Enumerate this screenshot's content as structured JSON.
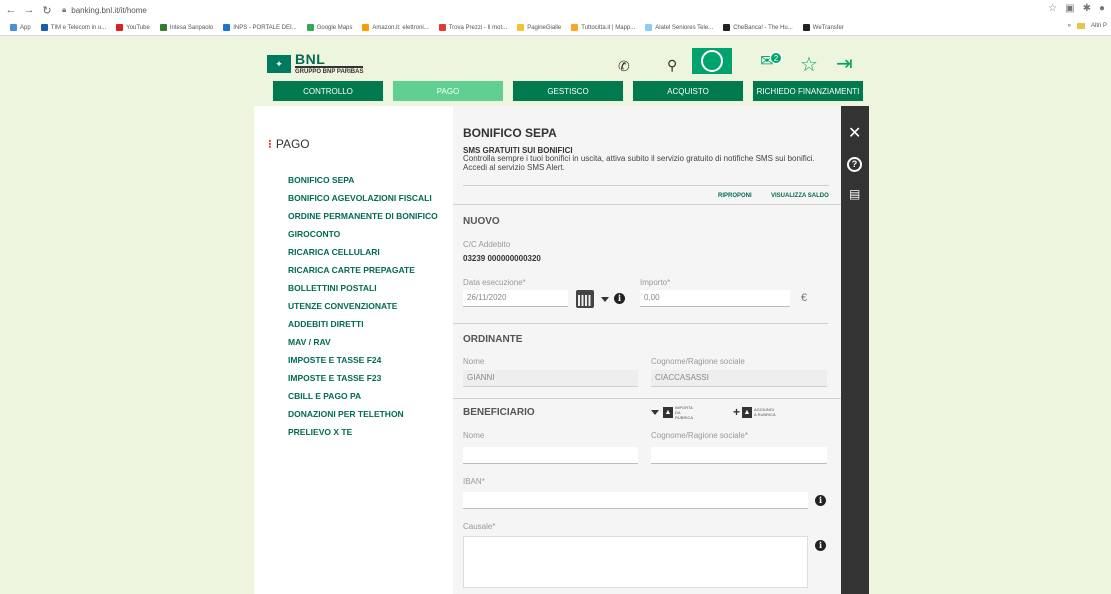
{
  "browser": {
    "url": "banking.bnl.it/it/home",
    "bookmarks": [
      {
        "label": "App",
        "color": "#4a90d9"
      },
      {
        "label": "TIM e Telecom in u...",
        "color": "#1a5bb5"
      },
      {
        "label": "YouTube",
        "color": "#e02020"
      },
      {
        "label": "Intesa Sanpaolo",
        "color": "#2e7d32"
      },
      {
        "label": "INPS - PORTALE DEI...",
        "color": "#1976d2"
      },
      {
        "label": "Google Maps",
        "color": "#34a853"
      },
      {
        "label": "Amazon.it: elettroni...",
        "color": "#ff9900"
      },
      {
        "label": "Trova Prezzi - Il mot...",
        "color": "#e53935"
      },
      {
        "label": "PagineGialle",
        "color": "#fbc02d"
      },
      {
        "label": "Tuttocitta.it | Mapp...",
        "color": "#f9a825"
      },
      {
        "label": "Alatel Seniores Tele...",
        "color": "#90caf9"
      },
      {
        "label": "CheBanca! - The Hu...",
        "color": "#222222"
      },
      {
        "label": "WeTransfer",
        "color": "#222222"
      }
    ],
    "other_bookmarks": "Altri P"
  },
  "header": {
    "logo_name": "BNL",
    "logo_sub": "GRUPPO BNP PARIBAS",
    "message_count": "2"
  },
  "topnav": [
    {
      "label": "CONTROLLO",
      "active": false
    },
    {
      "label": "PAGO",
      "active": true
    },
    {
      "label": "GESTISCO",
      "active": false
    },
    {
      "label": "ACQUISTO",
      "active": false
    },
    {
      "label": "RICHIEDO FINANZIAMENTI",
      "active": false
    }
  ],
  "sidebar": {
    "title": "PAGO",
    "items": [
      "BONIFICO SEPA",
      "BONIFICO AGEVOLAZIONI FISCALI",
      "ORDINE PERMANENTE DI BONIFICO",
      "GIROCONTO",
      "RICARICA CELLULARI",
      "RICARICA CARTE PREPAGATE",
      "BOLLETTINI POSTALI",
      "UTENZE CONVENZIONATE",
      "ADDEBITI DIRETTI",
      "MAV / RAV",
      "IMPOSTE E TASSE F24",
      "IMPOSTE E TASSE F23",
      "CBILL E PAGO PA",
      "DONAZIONI PER TELETHON",
      "PRELIEVO X TE"
    ]
  },
  "form": {
    "title": "BONIFICO SEPA",
    "sms_heading": "SMS GRATUITI SUI BONIFICI",
    "sms_text": "Controlla sempre i tuoi bonifici in uscita, attiva subito il servizio gratuito di notifiche SMS sui bonifici. Accedi al servizio SMS Alert.",
    "link_riproponi": "RIPROPONI",
    "link_saldo": "VISUALIZZA SALDO",
    "nuovo_heading": "NUOVO",
    "account_label": "C/C Addebito",
    "account_value": "03239 000000000320",
    "date_label": "Data esecuzione*",
    "date_value": "26/11/2020",
    "amount_label": "Importo*",
    "amount_value": "0,00",
    "currency": "€",
    "ordinante_heading": "ORDINANTE",
    "name_label": "Nome",
    "name_value": "GIANNI",
    "surname_label": "Cognome/Ragione sociale",
    "surname_value": "CIACCASASSI",
    "beneficiario_heading": "BENEFICIARIO",
    "import_label": "IMPORTA DA RUBRICA",
    "add_label": "AGGIUNGI A RUBRICA",
    "ben_name_label": "Nome",
    "ben_surname_label": "Cognome/Ragione sociale*",
    "iban_label": "IBAN*",
    "causale_label": "Causale*"
  }
}
